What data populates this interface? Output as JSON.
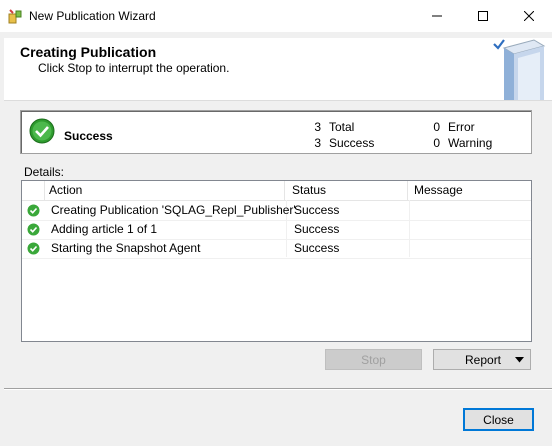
{
  "window": {
    "title": "New Publication Wizard"
  },
  "header": {
    "title": "Creating Publication",
    "subtitle": "Click Stop to interrupt the operation."
  },
  "summary": {
    "status": "Success",
    "total_count": "3",
    "total_label": "Total",
    "success_count": "3",
    "success_label": "Success",
    "error_count": "0",
    "error_label": "Error",
    "warning_count": "0",
    "warning_label": "Warning"
  },
  "details": {
    "label": "Details:",
    "columns": [
      "Action",
      "Status",
      "Message"
    ],
    "rows": [
      {
        "action": "Creating Publication 'SQLAG_Repl_Publisher'",
        "status": "Success",
        "message": ""
      },
      {
        "action": "Adding article 1 of 1",
        "status": "Success",
        "message": ""
      },
      {
        "action": "Starting the Snapshot Agent",
        "status": "Success",
        "message": ""
      }
    ]
  },
  "buttons": {
    "stop": "Stop",
    "report": "Report",
    "close": "Close"
  }
}
